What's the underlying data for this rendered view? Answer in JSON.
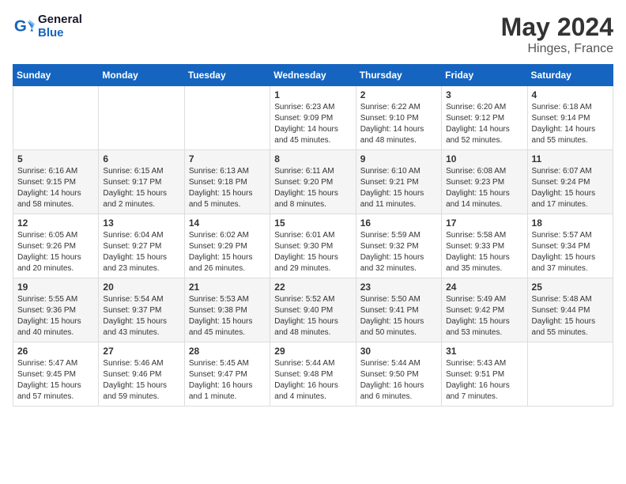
{
  "header": {
    "logo_line1": "General",
    "logo_line2": "Blue",
    "month": "May 2024",
    "location": "Hinges, France"
  },
  "weekdays": [
    "Sunday",
    "Monday",
    "Tuesday",
    "Wednesday",
    "Thursday",
    "Friday",
    "Saturday"
  ],
  "weeks": [
    [
      {
        "day": "",
        "sunrise": "",
        "sunset": "",
        "daylight": ""
      },
      {
        "day": "",
        "sunrise": "",
        "sunset": "",
        "daylight": ""
      },
      {
        "day": "",
        "sunrise": "",
        "sunset": "",
        "daylight": ""
      },
      {
        "day": "1",
        "sunrise": "Sunrise: 6:23 AM",
        "sunset": "Sunset: 9:09 PM",
        "daylight": "Daylight: 14 hours and 45 minutes."
      },
      {
        "day": "2",
        "sunrise": "Sunrise: 6:22 AM",
        "sunset": "Sunset: 9:10 PM",
        "daylight": "Daylight: 14 hours and 48 minutes."
      },
      {
        "day": "3",
        "sunrise": "Sunrise: 6:20 AM",
        "sunset": "Sunset: 9:12 PM",
        "daylight": "Daylight: 14 hours and 52 minutes."
      },
      {
        "day": "4",
        "sunrise": "Sunrise: 6:18 AM",
        "sunset": "Sunset: 9:14 PM",
        "daylight": "Daylight: 14 hours and 55 minutes."
      }
    ],
    [
      {
        "day": "5",
        "sunrise": "Sunrise: 6:16 AM",
        "sunset": "Sunset: 9:15 PM",
        "daylight": "Daylight: 14 hours and 58 minutes."
      },
      {
        "day": "6",
        "sunrise": "Sunrise: 6:15 AM",
        "sunset": "Sunset: 9:17 PM",
        "daylight": "Daylight: 15 hours and 2 minutes."
      },
      {
        "day": "7",
        "sunrise": "Sunrise: 6:13 AM",
        "sunset": "Sunset: 9:18 PM",
        "daylight": "Daylight: 15 hours and 5 minutes."
      },
      {
        "day": "8",
        "sunrise": "Sunrise: 6:11 AM",
        "sunset": "Sunset: 9:20 PM",
        "daylight": "Daylight: 15 hours and 8 minutes."
      },
      {
        "day": "9",
        "sunrise": "Sunrise: 6:10 AM",
        "sunset": "Sunset: 9:21 PM",
        "daylight": "Daylight: 15 hours and 11 minutes."
      },
      {
        "day": "10",
        "sunrise": "Sunrise: 6:08 AM",
        "sunset": "Sunset: 9:23 PM",
        "daylight": "Daylight: 15 hours and 14 minutes."
      },
      {
        "day": "11",
        "sunrise": "Sunrise: 6:07 AM",
        "sunset": "Sunset: 9:24 PM",
        "daylight": "Daylight: 15 hours and 17 minutes."
      }
    ],
    [
      {
        "day": "12",
        "sunrise": "Sunrise: 6:05 AM",
        "sunset": "Sunset: 9:26 PM",
        "daylight": "Daylight: 15 hours and 20 minutes."
      },
      {
        "day": "13",
        "sunrise": "Sunrise: 6:04 AM",
        "sunset": "Sunset: 9:27 PM",
        "daylight": "Daylight: 15 hours and 23 minutes."
      },
      {
        "day": "14",
        "sunrise": "Sunrise: 6:02 AM",
        "sunset": "Sunset: 9:29 PM",
        "daylight": "Daylight: 15 hours and 26 minutes."
      },
      {
        "day": "15",
        "sunrise": "Sunrise: 6:01 AM",
        "sunset": "Sunset: 9:30 PM",
        "daylight": "Daylight: 15 hours and 29 minutes."
      },
      {
        "day": "16",
        "sunrise": "Sunrise: 5:59 AM",
        "sunset": "Sunset: 9:32 PM",
        "daylight": "Daylight: 15 hours and 32 minutes."
      },
      {
        "day": "17",
        "sunrise": "Sunrise: 5:58 AM",
        "sunset": "Sunset: 9:33 PM",
        "daylight": "Daylight: 15 hours and 35 minutes."
      },
      {
        "day": "18",
        "sunrise": "Sunrise: 5:57 AM",
        "sunset": "Sunset: 9:34 PM",
        "daylight": "Daylight: 15 hours and 37 minutes."
      }
    ],
    [
      {
        "day": "19",
        "sunrise": "Sunrise: 5:55 AM",
        "sunset": "Sunset: 9:36 PM",
        "daylight": "Daylight: 15 hours and 40 minutes."
      },
      {
        "day": "20",
        "sunrise": "Sunrise: 5:54 AM",
        "sunset": "Sunset: 9:37 PM",
        "daylight": "Daylight: 15 hours and 43 minutes."
      },
      {
        "day": "21",
        "sunrise": "Sunrise: 5:53 AM",
        "sunset": "Sunset: 9:38 PM",
        "daylight": "Daylight: 15 hours and 45 minutes."
      },
      {
        "day": "22",
        "sunrise": "Sunrise: 5:52 AM",
        "sunset": "Sunset: 9:40 PM",
        "daylight": "Daylight: 15 hours and 48 minutes."
      },
      {
        "day": "23",
        "sunrise": "Sunrise: 5:50 AM",
        "sunset": "Sunset: 9:41 PM",
        "daylight": "Daylight: 15 hours and 50 minutes."
      },
      {
        "day": "24",
        "sunrise": "Sunrise: 5:49 AM",
        "sunset": "Sunset: 9:42 PM",
        "daylight": "Daylight: 15 hours and 53 minutes."
      },
      {
        "day": "25",
        "sunrise": "Sunrise: 5:48 AM",
        "sunset": "Sunset: 9:44 PM",
        "daylight": "Daylight: 15 hours and 55 minutes."
      }
    ],
    [
      {
        "day": "26",
        "sunrise": "Sunrise: 5:47 AM",
        "sunset": "Sunset: 9:45 PM",
        "daylight": "Daylight: 15 hours and 57 minutes."
      },
      {
        "day": "27",
        "sunrise": "Sunrise: 5:46 AM",
        "sunset": "Sunset: 9:46 PM",
        "daylight": "Daylight: 15 hours and 59 minutes."
      },
      {
        "day": "28",
        "sunrise": "Sunrise: 5:45 AM",
        "sunset": "Sunset: 9:47 PM",
        "daylight": "Daylight: 16 hours and 1 minute."
      },
      {
        "day": "29",
        "sunrise": "Sunrise: 5:44 AM",
        "sunset": "Sunset: 9:48 PM",
        "daylight": "Daylight: 16 hours and 4 minutes."
      },
      {
        "day": "30",
        "sunrise": "Sunrise: 5:44 AM",
        "sunset": "Sunset: 9:50 PM",
        "daylight": "Daylight: 16 hours and 6 minutes."
      },
      {
        "day": "31",
        "sunrise": "Sunrise: 5:43 AM",
        "sunset": "Sunset: 9:51 PM",
        "daylight": "Daylight: 16 hours and 7 minutes."
      },
      {
        "day": "",
        "sunrise": "",
        "sunset": "",
        "daylight": ""
      }
    ]
  ]
}
